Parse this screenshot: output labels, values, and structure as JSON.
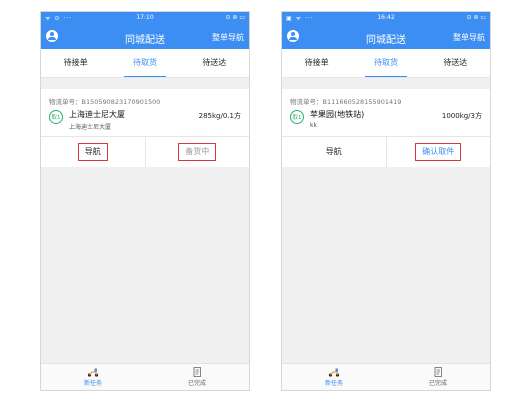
{
  "phones": [
    {
      "status": {
        "left": "ᯤ ⊙ ···",
        "time": "17:10",
        "right": "⊙ ⊚ ▭"
      },
      "header": {
        "title": "同城配送",
        "right_action": "整单导航"
      },
      "tabs": [
        {
          "label": "待接单",
          "active": false
        },
        {
          "label": "待取货",
          "active": true
        },
        {
          "label": "待送达",
          "active": false
        }
      ],
      "order": {
        "number_label": "物流单号：B150590823170901500",
        "badge": "取1",
        "destination": "上海迪士尼大厦",
        "address": "上海迪士尼大厦",
        "weight": "285kg/0.1方"
      },
      "actions": [
        {
          "label": "导航"
        },
        {
          "label": "备货中"
        }
      ],
      "bottom_tabs": [
        {
          "label": "新任务",
          "icon": "scooter-icon",
          "active": true
        },
        {
          "label": "已完成",
          "icon": "document-icon",
          "active": false
        }
      ]
    },
    {
      "status": {
        "left": "▣ ᯤ ···",
        "time": "16:42",
        "right": "⊙ ⊚ ▭"
      },
      "header": {
        "title": "同城配送",
        "right_action": "整单导航"
      },
      "tabs": [
        {
          "label": "待接单",
          "active": false
        },
        {
          "label": "待取货",
          "active": true
        },
        {
          "label": "待送达",
          "active": false
        }
      ],
      "order": {
        "number_label": "物流单号：B111660528155901419",
        "badge": "取1",
        "destination": "苹果园(地铁站)",
        "address": "kk",
        "weight": "1000kg/3方"
      },
      "actions": [
        {
          "label": "导航"
        },
        {
          "label": "确认取件"
        }
      ],
      "bottom_tabs": [
        {
          "label": "新任务",
          "icon": "scooter-icon",
          "active": true
        },
        {
          "label": "已完成",
          "icon": "document-icon",
          "active": false
        }
      ]
    }
  ],
  "colors": {
    "primary": "#3d8ef3",
    "highlight_box": "#d9363e",
    "badge": "#2fb36b"
  }
}
